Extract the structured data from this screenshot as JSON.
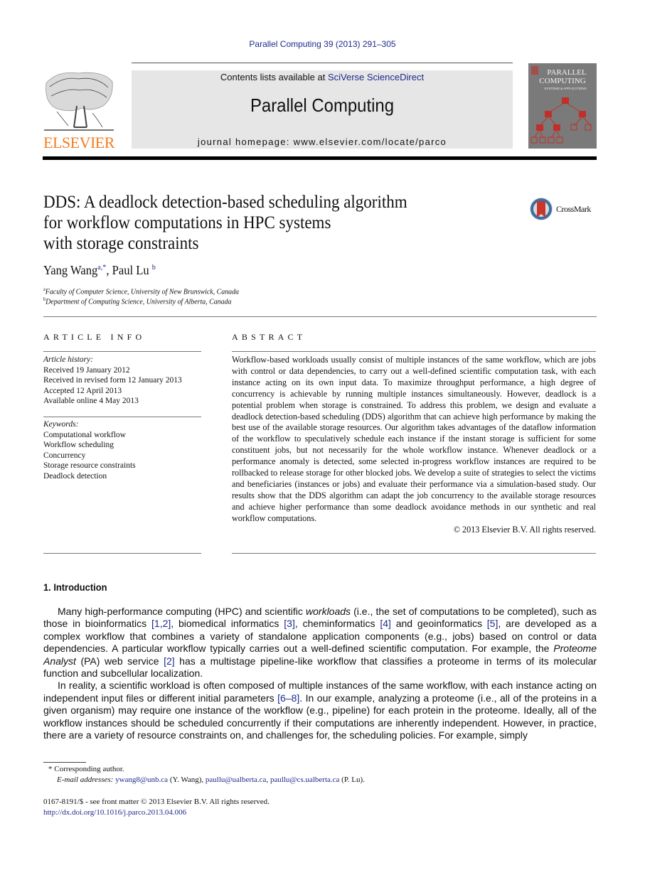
{
  "header": {
    "citation": "Parallel Computing 39 (2013) 291–305",
    "contents_prefix": "Contents lists available at ",
    "contents_link": "SciVerse ScienceDirect",
    "journal_name": "Parallel Computing",
    "homepage_prefix": "journal homepage: ",
    "homepage_url": "www.elsevier.com/locate/parco",
    "publisher_logo_text": "ELSEVIER",
    "cover": {
      "title_line1": "PARALLEL",
      "title_line2": "COMPUTING",
      "subtitle": "SYSTEMS & APPLICATIONS"
    },
    "colors": {
      "elsevier_orange": "#f47b20",
      "cover_gray": "#7a7a7a",
      "cover_red": "#c0302a",
      "banner_gray": "#e6e6e6",
      "link_blue": "#1f2a8c"
    }
  },
  "article": {
    "title_lines": [
      "DDS: A deadlock detection-based scheduling algorithm",
      "for workflow computations in HPC systems",
      "with storage constraints"
    ],
    "crossmark_label": "CrossMark",
    "authors": [
      {
        "name": "Yang Wang",
        "sup": "a,*"
      },
      {
        "name": "Paul Lu",
        "sup": "b"
      }
    ],
    "author_separator": ", ",
    "affiliations": [
      {
        "sup": "a",
        "text": "Faculty of Computer Science, University of New Brunswick, Canada"
      },
      {
        "sup": "b",
        "text": "Department of Computing Science, University of Alberta, Canada"
      }
    ]
  },
  "article_info": {
    "heading": "ARTICLE INFO",
    "history_label": "Article history:",
    "history": [
      "Received 19 January 2012",
      "Received in revised form 12 January 2013",
      "Accepted 12 April 2013",
      "Available online 4 May 2013"
    ],
    "keywords_label": "Keywords:",
    "keywords": [
      "Computational workflow",
      "Workflow scheduling",
      "Concurrency",
      "Storage resource constraints",
      "Deadlock detection"
    ]
  },
  "abstract": {
    "heading": "ABSTRACT",
    "text": "Workflow-based workloads usually consist of multiple instances of the same workflow, which are jobs with control or data dependencies, to carry out a well-defined scientific computation task, with each instance acting on its own input data. To maximize throughput performance, a high degree of concurrency is achievable by running multiple instances simultaneously. However, deadlock is a potential problem when storage is constrained. To address this problem, we design and evaluate a deadlock detection-based scheduling (DDS) algorithm that can achieve high performance by making the best use of the available storage resources. Our algorithm takes advantages of the dataflow information of the workflow to speculatively schedule each instance if the instant storage is sufficient for some constituent jobs, but not necessarily for the whole workflow instance. Whenever deadlock or a performance anomaly is detected, some selected in-progress workflow instances are required to be rollbacked to release storage for other blocked jobs. We develop a suite of strategies to select the victims and beneficiaries (instances or jobs) and evaluate their performance via a simulation-based study. Our results show that the DDS algorithm can adapt the job concurrency to the available storage resources and achieve higher performance than some deadlock avoidance methods in our synthetic and real workflow computations.",
    "copyright": "© 2013 Elsevier B.V. All rights reserved."
  },
  "introduction": {
    "heading": "1. Introduction",
    "p1": {
      "s1": "Many high-performance computing (HPC) and scientific ",
      "s1_ital": "workloads",
      "s2": " (i.e., the set of computations to be completed), such as those in bioinformatics ",
      "ref1": "[1,2]",
      "s3": ", biomedical informatics ",
      "ref2": "[3]",
      "s4": ", cheminformatics ",
      "ref3": "[4]",
      "s5": " and geoinformatics ",
      "ref4": "[5]",
      "s6": ", are developed as a complex workflow that combines a variety of standalone application components (e.g., jobs) based on control or data dependencies. A particular workflow typically carries out a well-defined scientific computation. For example, the ",
      "s6_ital": "Proteome Analyst",
      "s7": " (PA) web service ",
      "ref5": "[2]",
      "s8": " has a multistage pipeline-like workflow that classifies a proteome in terms of its molecular function and subcellular localization."
    },
    "p2": {
      "s1": "In reality, a scientific workload is often composed of multiple instances of the same workflow, with each instance acting on independent input files or different initial parameters ",
      "ref1": "[6–8]",
      "s2": ". In our example, analyzing a proteome (i.e., all of the proteins in a given organism) may require one instance of the workflow (e.g., pipeline) for each protein in the proteome. Ideally, all of the workflow instances should be scheduled concurrently if their computations are inherently independent. However, in practice, there are a variety of resource constraints on, and challenges for, the scheduling policies. For example, simply"
    }
  },
  "footnotes": {
    "corresponding_mark": "*",
    "corresponding_text": "Corresponding author.",
    "email_label": "E-mail addresses:",
    "email1": "ywang8@unb.ca",
    "email1_owner": " (Y. Wang), ",
    "email2": "paullu@ualberta.ca",
    "email_sep": ", ",
    "email3": "paullu@cs.ualberta.ca",
    "email3_owner": " (P. Lu)."
  },
  "front_matter": {
    "issn_line": "0167-8191/$ - see front matter © 2013 Elsevier B.V. All rights reserved.",
    "doi": "http://dx.doi.org/10.1016/j.parco.2013.04.006"
  }
}
